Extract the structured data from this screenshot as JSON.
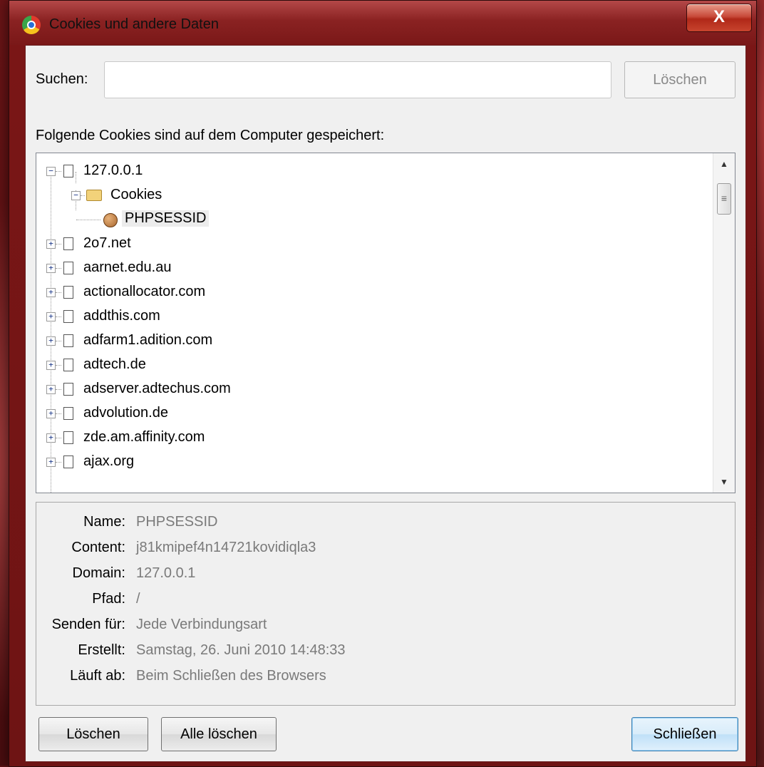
{
  "window": {
    "title": "Cookies und andere Daten",
    "close_label": "X"
  },
  "search": {
    "label": "Suchen:",
    "value": "",
    "clear_label": "Löschen"
  },
  "list_caption": "Folgende Cookies sind auf dem Computer gespeichert:",
  "tree": {
    "root": {
      "label": "127.0.0.1",
      "folder": "Cookies",
      "cookie": "PHPSESSID"
    },
    "sites": [
      "2o7.net",
      "aarnet.edu.au",
      "actionallocator.com",
      "addthis.com",
      "adfarm1.adition.com",
      "adtech.de",
      "adserver.adtechus.com",
      "advolution.de",
      "zde.am.affinity.com",
      "ajax.org"
    ]
  },
  "details": [
    {
      "key": "Name:",
      "value": "PHPSESSID"
    },
    {
      "key": "Content:",
      "value": "j81kmipef4n14721kovidiqla3"
    },
    {
      "key": "Domain:",
      "value": "127.0.0.1"
    },
    {
      "key": "Pfad:",
      "value": "/"
    },
    {
      "key": "Senden für:",
      "value": "Jede Verbindungsart"
    },
    {
      "key": "Erstellt:",
      "value": "Samstag, 26. Juni 2010 14:48:33"
    },
    {
      "key": "Läuft ab:",
      "value": "Beim Schließen des Browsers"
    }
  ],
  "buttons": {
    "delete": "Löschen",
    "delete_all": "Alle löschen",
    "close": "Schließen"
  }
}
